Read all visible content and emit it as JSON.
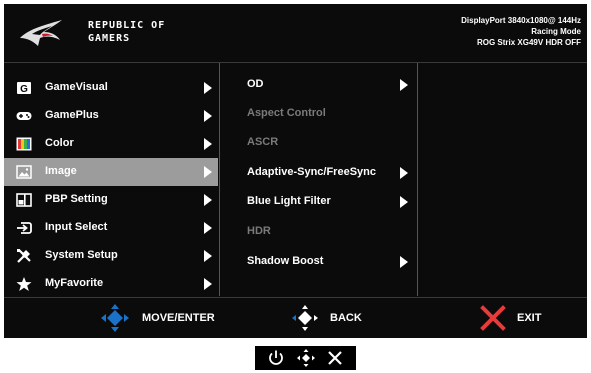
{
  "header": {
    "brand_line1": "REPUBLIC OF",
    "brand_line2": "GAMERS",
    "status_line1": "DisplayPort 3840x1080@ 144Hz",
    "status_line2": "Racing Mode",
    "status_line3": "ROG Strix XG49V HDR OFF"
  },
  "main_menu": [
    {
      "label": "GameVisual",
      "icon": "gamevisual-icon"
    },
    {
      "label": "GamePlus",
      "icon": "gamepad-icon"
    },
    {
      "label": "Color",
      "icon": "color-icon"
    },
    {
      "label": "Image",
      "icon": "image-icon",
      "selected": true
    },
    {
      "label": "PBP Setting",
      "icon": "pbp-icon"
    },
    {
      "label": "Input Select",
      "icon": "input-icon"
    },
    {
      "label": "System Setup",
      "icon": "tools-icon"
    },
    {
      "label": "MyFavorite",
      "icon": "star-icon"
    }
  ],
  "sub_menu": [
    {
      "label": "OD",
      "enabled": true
    },
    {
      "label": "Aspect Control",
      "enabled": false
    },
    {
      "label": "ASCR",
      "enabled": false
    },
    {
      "label": "Adaptive-Sync/FreeSync",
      "enabled": true
    },
    {
      "label": "Blue Light Filter",
      "enabled": true
    },
    {
      "label": "HDR",
      "enabled": false
    },
    {
      "label": "Shadow Boost",
      "enabled": true
    }
  ],
  "footer": {
    "move_label": "MOVE/ENTER",
    "back_label": "BACK",
    "exit_label": "EXIT"
  },
  "colors": {
    "osd_background": "#0b0b0b",
    "selected_row": "#9c9c9c",
    "nav_blue": "#1a73c8",
    "exit_red": "#e83a3a",
    "disabled_text": "#7a7a7a"
  }
}
